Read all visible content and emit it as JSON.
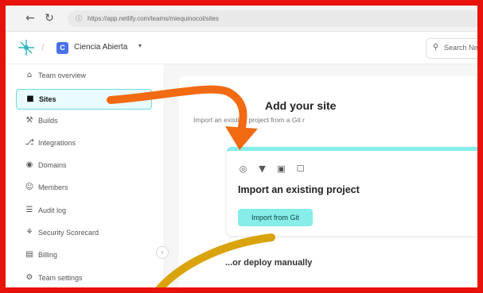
{
  "browser": {
    "back_icon": "arrow-left",
    "reload_icon": "reload",
    "url": "https://app.netlify.com/teams/miequinocol/sites"
  },
  "header": {
    "team_badge": "C",
    "team_name": "Ciencia Abierta",
    "search_placeholder": "Search Net"
  },
  "sidebar": {
    "items": [
      {
        "label": "Team overview",
        "icon": "home"
      },
      {
        "label": "Sites",
        "icon": "lock",
        "active": true
      },
      {
        "label": "Builds",
        "icon": "wrench"
      },
      {
        "label": "Integrations",
        "icon": "plug"
      },
      {
        "label": "Domains",
        "icon": "globe"
      },
      {
        "label": "Members",
        "icon": "people"
      },
      {
        "label": "Audit log",
        "icon": "log"
      },
      {
        "label": "Security Scorecard",
        "icon": "shield"
      },
      {
        "label": "Billing",
        "icon": "receipt"
      },
      {
        "label": "Team settings",
        "icon": "gear"
      }
    ]
  },
  "main": {
    "title": "Add your site",
    "subtitle": "Import an existing project from a Git r",
    "card": {
      "title": "Import an existing project",
      "providers": [
        "github",
        "gitlab",
        "bitbucket",
        "azure"
      ],
      "button": "Import from Git"
    },
    "deploy_manually": "...or deploy manually"
  },
  "colors": {
    "frame": "#e8120c",
    "accent": "#86ede8",
    "arrow_orange": "#f26a12",
    "arrow_yellow": "#d9a40b"
  }
}
